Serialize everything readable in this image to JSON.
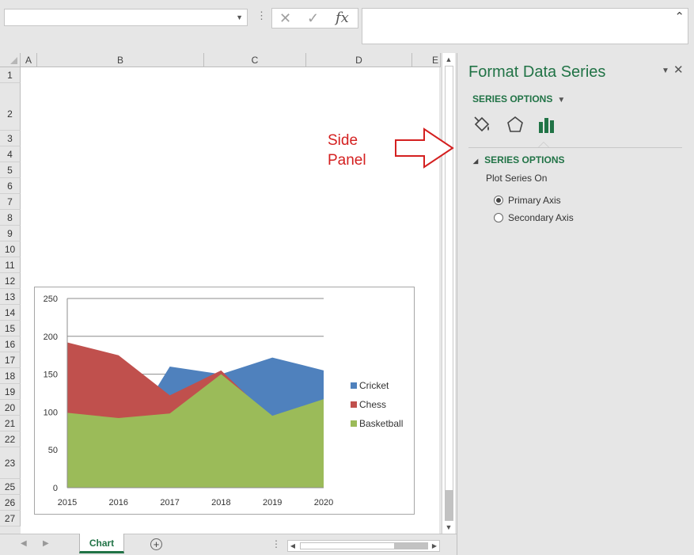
{
  "formula_bar": {
    "name_box": "",
    "cancel_icon": "✕",
    "enter_icon": "✓",
    "fx_label": "fx",
    "formula": ""
  },
  "columns": [
    "A",
    "B",
    "C",
    "D",
    "E"
  ],
  "rows": [
    "1",
    "2",
    "3",
    "4",
    "5",
    "6",
    "7",
    "8",
    "9",
    "10",
    "11",
    "12",
    "13",
    "14",
    "15",
    "16",
    "17",
    "18",
    "19",
    "20",
    "21",
    "22",
    "23",
    "25",
    "26",
    "27"
  ],
  "annotation": {
    "line1": "Side",
    "line2": "Panel",
    "color": "#d42020"
  },
  "sheet_tabs": [
    {
      "label": "Chart",
      "active": true
    }
  ],
  "side_panel": {
    "title": "Format Data Series",
    "dropdown_label": "SERIES OPTIONS",
    "section_title": "SERIES OPTIONS",
    "plot_series_on": "Plot Series On",
    "options": [
      {
        "label": "Primary Axis",
        "selected": true
      },
      {
        "label": "Secondary Axis",
        "selected": false
      }
    ],
    "accent": "#217346"
  },
  "chart_data": {
    "type": "area",
    "x": [
      "2015",
      "2016",
      "2017",
      "2018",
      "2019",
      "2020"
    ],
    "ylim": [
      0,
      250
    ],
    "yticks": [
      "0",
      "50",
      "100",
      "150",
      "200",
      "250"
    ],
    "series": [
      {
        "name": "Cricket",
        "color": "#4f81bd",
        "values": [
          25,
          50,
          160,
          150,
          172,
          155
        ]
      },
      {
        "name": "Chess",
        "color": "#c0504d",
        "values": [
          192,
          175,
          122,
          155,
          90,
          95
        ]
      },
      {
        "name": "Basketball",
        "color": "#9bbb59",
        "values": [
          99,
          92,
          98,
          150,
          95,
          117
        ]
      }
    ],
    "grid": true,
    "legend_position": "right"
  }
}
